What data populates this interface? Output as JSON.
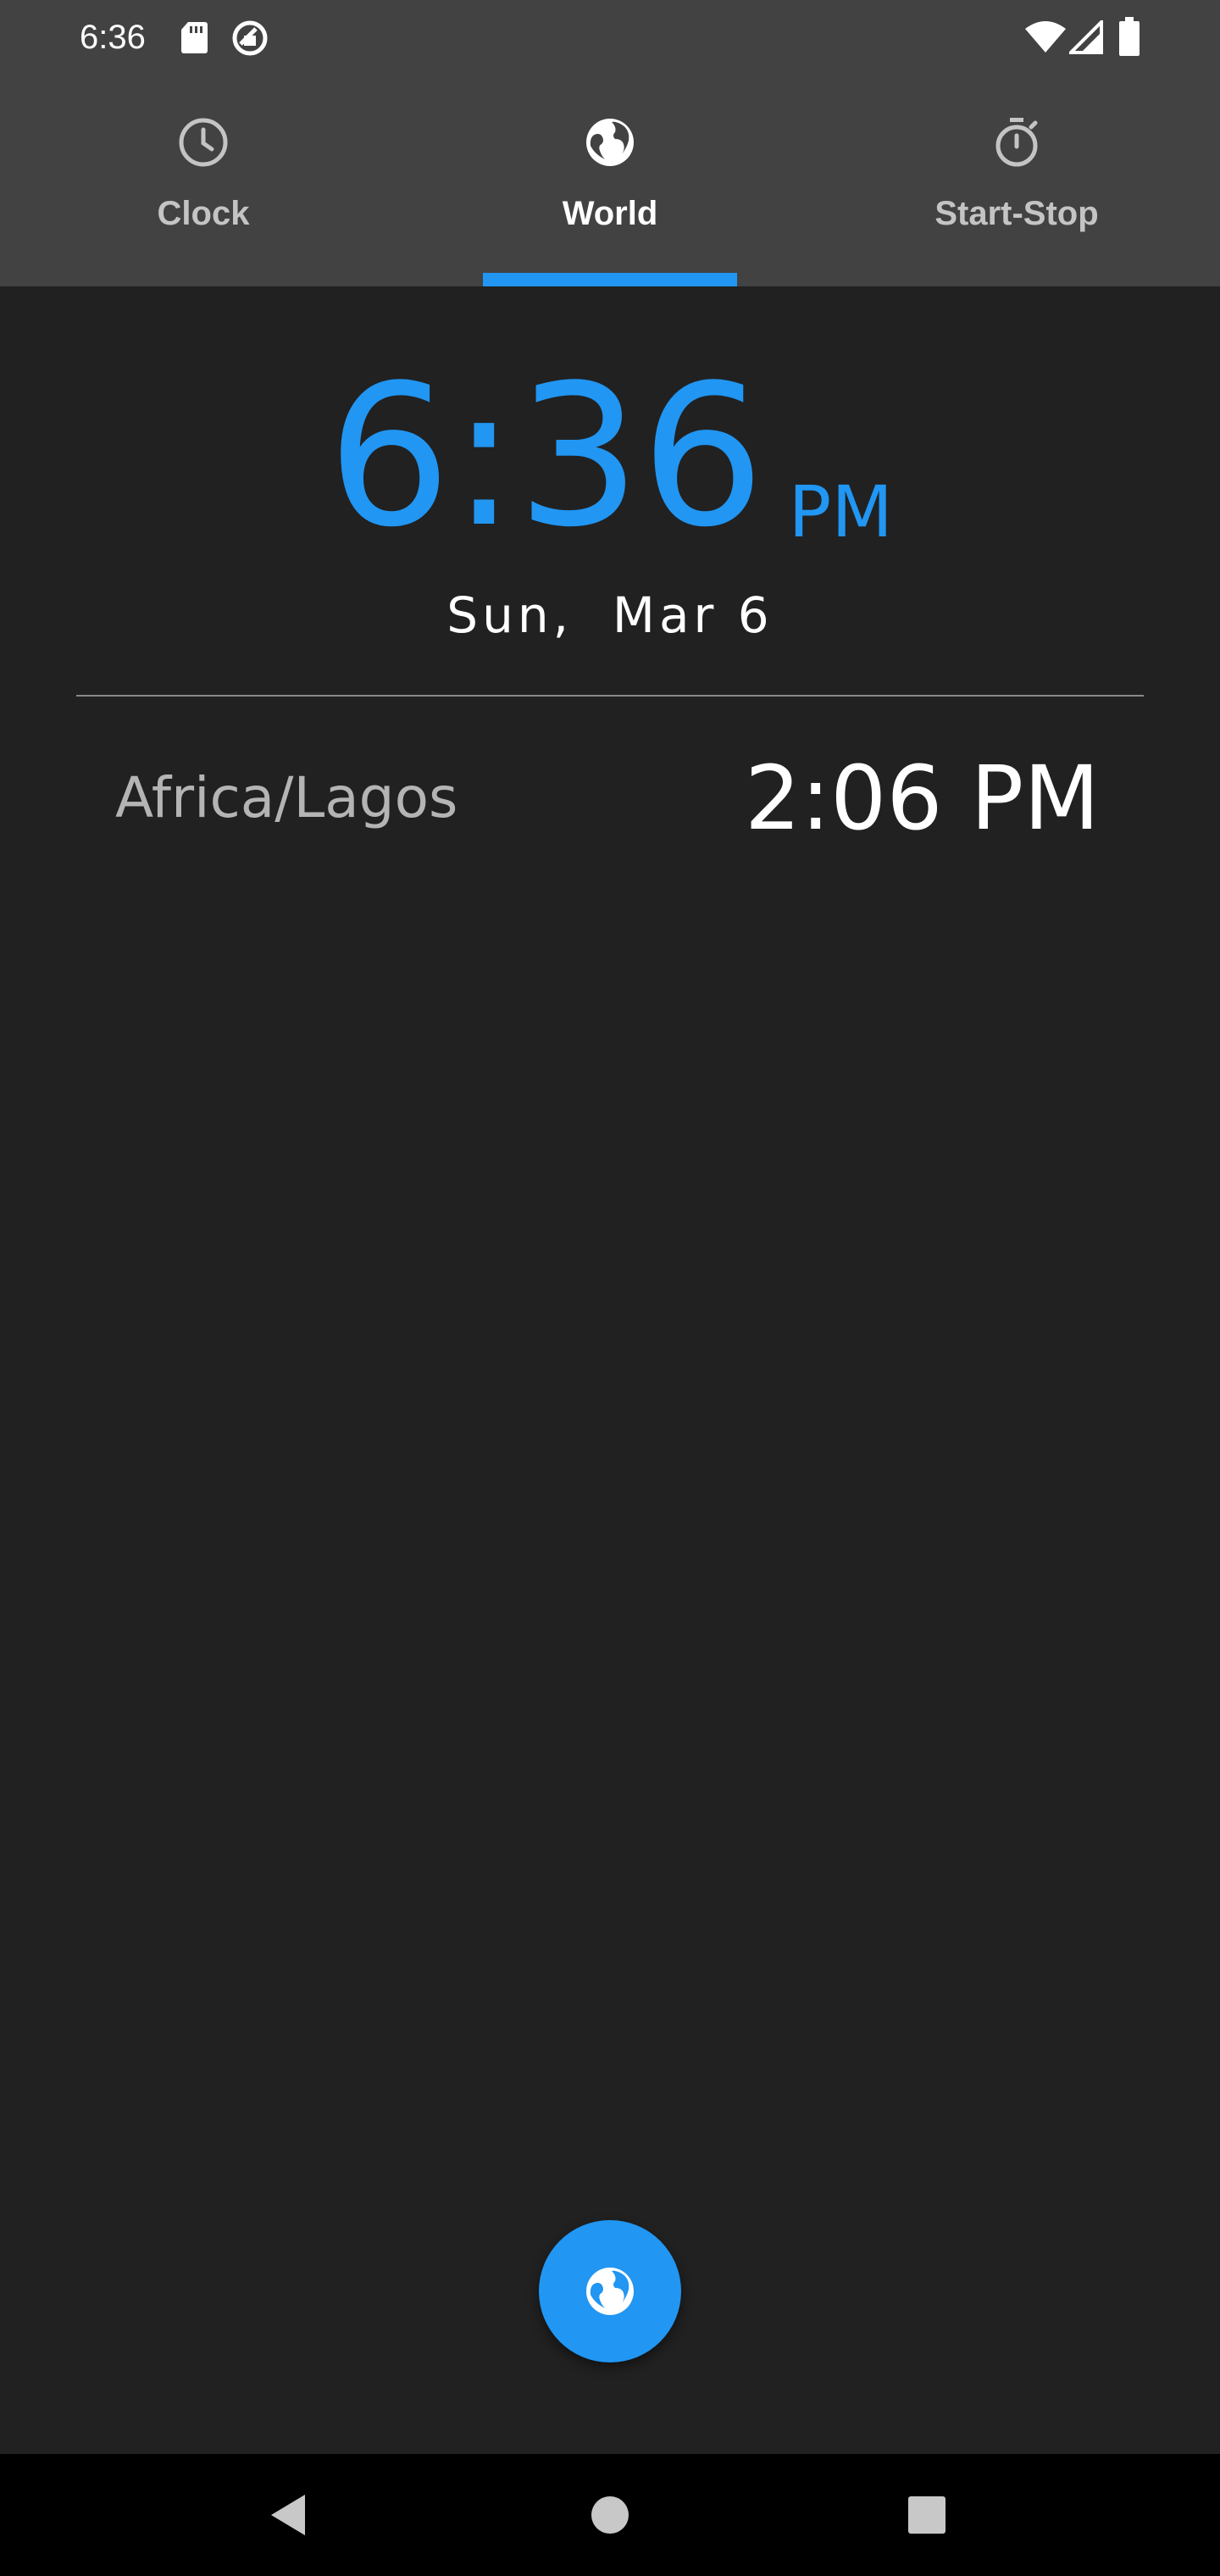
{
  "status_bar": {
    "time": "6:36",
    "icons": [
      "sd-card-icon",
      "rotate-lock-icon",
      "wifi-icon",
      "signal-icon",
      "battery-icon"
    ]
  },
  "tabs": [
    {
      "label": "Clock",
      "icon": "clock-icon",
      "active": false
    },
    {
      "label": "World",
      "icon": "globe-icon",
      "active": true
    },
    {
      "label": "Start-Stop",
      "icon": "stopwatch-icon",
      "active": false
    }
  ],
  "main_clock": {
    "time": "6:36",
    "ampm": "PM",
    "date": "Sun,  Mar 6"
  },
  "world_clocks": [
    {
      "city": "Africa/Lagos",
      "time": "2:06 PM"
    }
  ],
  "fab": {
    "icon": "globe-icon"
  },
  "nav_bar": {
    "buttons": [
      "back-icon",
      "home-icon",
      "recents-icon"
    ]
  },
  "colors": {
    "accent": "#2196f3",
    "app_bar": "#424242",
    "background": "#212121",
    "nav_bar": "#000000",
    "text_primary": "#ffffff",
    "text_secondary": "#b4b4b4"
  }
}
